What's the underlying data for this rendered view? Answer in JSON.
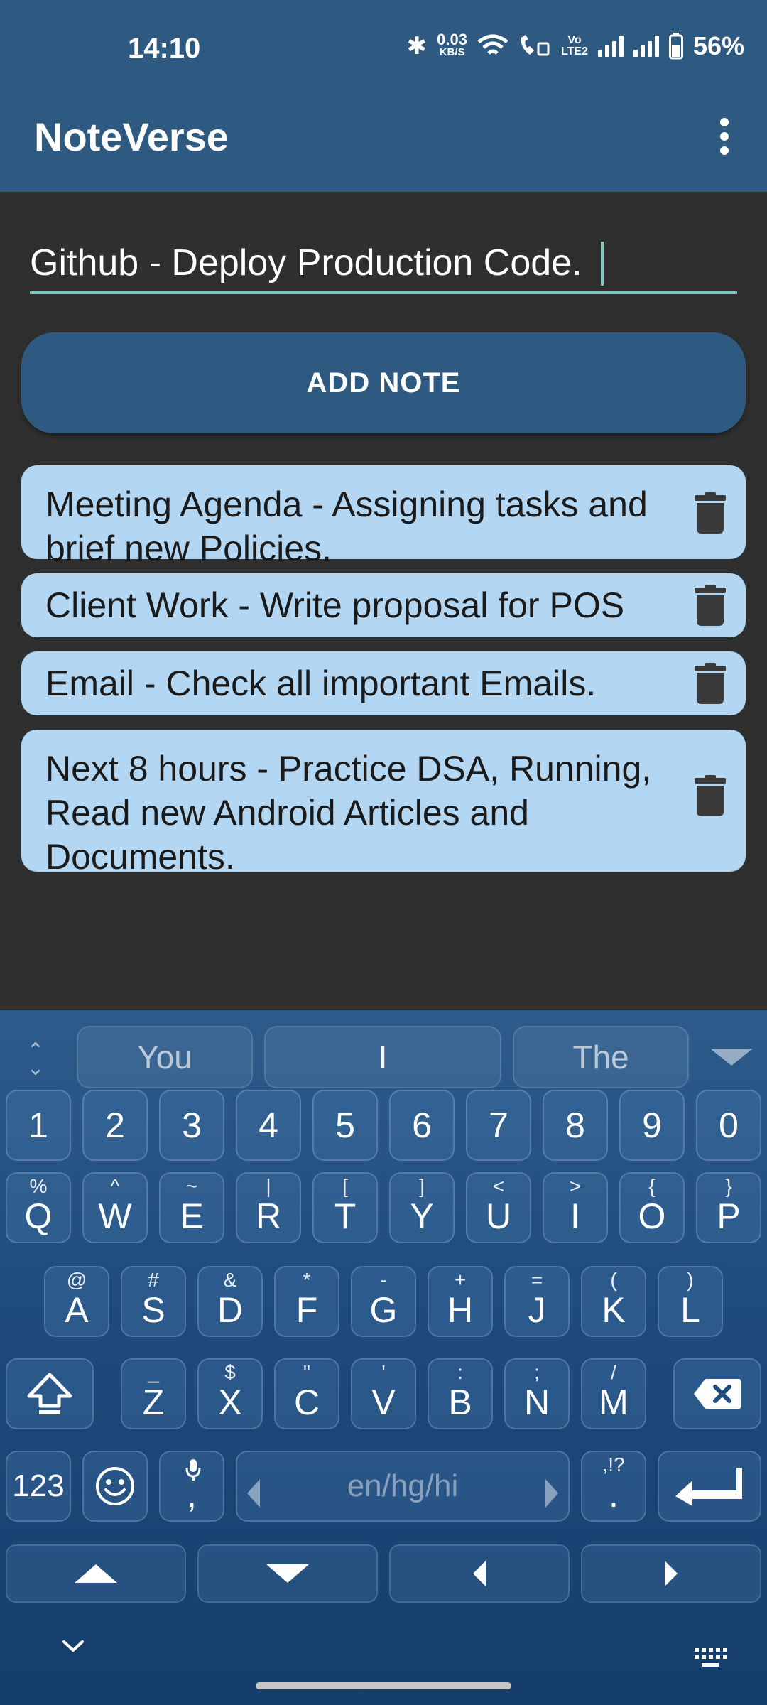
{
  "status_bar": {
    "time": "14:10",
    "net_speed_value": "0.03",
    "net_speed_unit": "KB/S",
    "volte_line1": "Vo",
    "volte_line2": "LTE2",
    "battery": "56%",
    "icons": [
      "bluetooth-icon",
      "wifi-icon",
      "wifi-calling-icon",
      "signal-icon",
      "battery-icon"
    ]
  },
  "app_bar": {
    "title": "NoteVerse",
    "menu_icon": "overflow-menu-icon"
  },
  "note_input": {
    "value": "Github - Deploy Production Code."
  },
  "add_button": {
    "label": "ADD NOTE"
  },
  "notes": [
    {
      "text": "Meeting Agenda - Assigning tasks and brief new Policies."
    },
    {
      "text": "Client Work - Write proposal for POS"
    },
    {
      "text": "Email - Check all important Emails."
    },
    {
      "text": "Next 8 hours - Practice DSA, Running, Read new Android Articles and Documents."
    }
  ],
  "keyboard": {
    "suggestions": [
      "You",
      "I",
      "The"
    ],
    "number_row": [
      "1",
      "2",
      "3",
      "4",
      "5",
      "6",
      "7",
      "8",
      "9",
      "0"
    ],
    "row1": [
      {
        "key": "Q",
        "alt": "%"
      },
      {
        "key": "W",
        "alt": "^"
      },
      {
        "key": "E",
        "alt": "~"
      },
      {
        "key": "R",
        "alt": "|"
      },
      {
        "key": "T",
        "alt": "["
      },
      {
        "key": "Y",
        "alt": "]"
      },
      {
        "key": "U",
        "alt": "<"
      },
      {
        "key": "I",
        "alt": ">"
      },
      {
        "key": "O",
        "alt": "{"
      },
      {
        "key": "P",
        "alt": "}"
      }
    ],
    "row2": [
      {
        "key": "A",
        "alt": "@"
      },
      {
        "key": "S",
        "alt": "#"
      },
      {
        "key": "D",
        "alt": "&"
      },
      {
        "key": "F",
        "alt": "*"
      },
      {
        "key": "G",
        "alt": "-"
      },
      {
        "key": "H",
        "alt": "+"
      },
      {
        "key": "J",
        "alt": "="
      },
      {
        "key": "K",
        "alt": "("
      },
      {
        "key": "L",
        "alt": ")"
      }
    ],
    "row3": [
      {
        "key": "Z",
        "alt": "_"
      },
      {
        "key": "X",
        "alt": "$"
      },
      {
        "key": "C",
        "alt": "\""
      },
      {
        "key": "V",
        "alt": "'"
      },
      {
        "key": "B",
        "alt": ":"
      },
      {
        "key": "N",
        "alt": ";"
      },
      {
        "key": "M",
        "alt": "/"
      }
    ],
    "symbols_key": "123",
    "comma_key": ",",
    "space_label": "en/hg/hi",
    "period_key": ".",
    "period_alt": ",!?"
  }
}
